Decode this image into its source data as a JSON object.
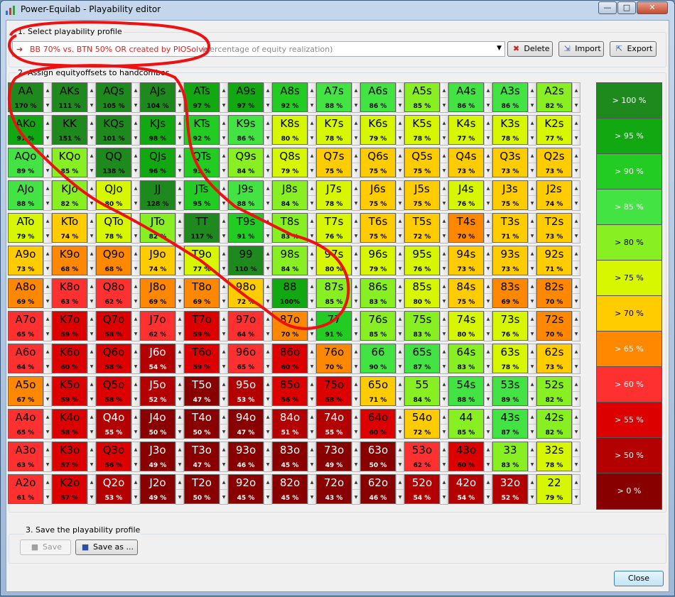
{
  "window": {
    "title": "Power-Equilab - Playability editor",
    "controls": [
      "—",
      "□",
      "✕"
    ]
  },
  "section1": {
    "label": "1. Select playability profile",
    "selected": "BB 70% vs. BTN 50% OR created by PIOSolver",
    "hint": "(percentage of equity realization)",
    "icon": "red-arrow-icon",
    "buttons": {
      "delete": "Delete",
      "import": "Import",
      "export": "Export"
    }
  },
  "section2": {
    "label": "2. Assign equityoffsets to handcombos"
  },
  "section3": {
    "label": "3. Save the playability profile",
    "save": "Save",
    "save_as": "Save as ..."
  },
  "close": "Close",
  "legend": [
    "> 100 %",
    "> 95 %",
    "> 90 %",
    "> 85 %",
    "> 80 %",
    "> 75 %",
    "> 70 %",
    "> 65 %",
    "> 60 %",
    "> 55 %",
    "> 50 %",
    "> 0 %"
  ],
  "colors": {
    "100": "#1e8a1e",
    "95": "#11a811",
    "90": "#22cc22",
    "85": "#44e344",
    "80": "#88f022",
    "75": "#d6f700",
    "70": "#ffcc00",
    "65": "#ff8800",
    "60": "#ff3030",
    "55": "#dd0000",
    "50": "#b30000",
    "0": "#880000"
  },
  "grid": [
    [
      [
        "AA",
        "170 %"
      ],
      [
        "AKs",
        "111 %"
      ],
      [
        "AQs",
        "105 %"
      ],
      [
        "AJs",
        "104 %"
      ],
      [
        "ATs",
        "97 %"
      ],
      [
        "A9s",
        "97 %"
      ],
      [
        "A8s",
        "92 %"
      ],
      [
        "A7s",
        "88 %"
      ],
      [
        "A6s",
        "86 %"
      ],
      [
        "A5s",
        "85 %"
      ],
      [
        "A4s",
        "86 %"
      ],
      [
        "A3s",
        "86 %"
      ],
      [
        "A2s",
        "82 %"
      ]
    ],
    [
      [
        "AKo",
        "97 %"
      ],
      [
        "KK",
        "151 %"
      ],
      [
        "KQs",
        "101 %"
      ],
      [
        "KJs",
        "98 %"
      ],
      [
        "KTs",
        "92 %"
      ],
      [
        "K9s",
        "86 %"
      ],
      [
        "K8s",
        "80 %"
      ],
      [
        "K7s",
        "78 %"
      ],
      [
        "K6s",
        "79 %"
      ],
      [
        "K5s",
        "78 %"
      ],
      [
        "K4s",
        "77 %"
      ],
      [
        "K3s",
        "78 %"
      ],
      [
        "K2s",
        "77 %"
      ]
    ],
    [
      [
        "AQo",
        "89 %"
      ],
      [
        "KQo",
        "85 %"
      ],
      [
        "QQ",
        "138 %"
      ],
      [
        "QJs",
        "96 %"
      ],
      [
        "QTs",
        "93 %"
      ],
      [
        "Q9s",
        "84 %"
      ],
      [
        "Q8s",
        "79 %"
      ],
      [
        "Q7s",
        "75 %"
      ],
      [
        "Q6s",
        "75 %"
      ],
      [
        "Q5s",
        "75 %"
      ],
      [
        "Q4s",
        "73 %"
      ],
      [
        "Q3s",
        "73 %"
      ],
      [
        "Q2s",
        "73 %"
      ]
    ],
    [
      [
        "AJo",
        "88 %"
      ],
      [
        "KJo",
        "82 %"
      ],
      [
        "QJo",
        "80 %"
      ],
      [
        "JJ",
        "128 %"
      ],
      [
        "JTs",
        "95 %"
      ],
      [
        "J9s",
        "88 %"
      ],
      [
        "J8s",
        "84 %"
      ],
      [
        "J7s",
        "78 %"
      ],
      [
        "J6s",
        "75 %"
      ],
      [
        "J5s",
        "75 %"
      ],
      [
        "J4s",
        "76 %"
      ],
      [
        "J3s",
        "75 %"
      ],
      [
        "J2s",
        "74 %"
      ]
    ],
    [
      [
        "ATo",
        "79 %"
      ],
      [
        "KTo",
        "74 %"
      ],
      [
        "QTo",
        "78 %"
      ],
      [
        "JTo",
        "82 %"
      ],
      [
        "TT",
        "117 %"
      ],
      [
        "T9s",
        "91 %"
      ],
      [
        "T8s",
        "83 %"
      ],
      [
        "T7s",
        "76 %"
      ],
      [
        "T6s",
        "75 %"
      ],
      [
        "T5s",
        "72 %"
      ],
      [
        "T4s",
        "70 %"
      ],
      [
        "T3s",
        "71 %"
      ],
      [
        "T2s",
        "73 %"
      ]
    ],
    [
      [
        "A9o",
        "73 %"
      ],
      [
        "K9o",
        "68 %"
      ],
      [
        "Q9o",
        "68 %"
      ],
      [
        "J9o",
        "74 %"
      ],
      [
        "T9o",
        "77 %"
      ],
      [
        "99",
        "110 %"
      ],
      [
        "98s",
        "84 %"
      ],
      [
        "97s",
        "80 %"
      ],
      [
        "96s",
        "79 %"
      ],
      [
        "95s",
        "76 %"
      ],
      [
        "94s",
        "73 %"
      ],
      [
        "93s",
        "73 %"
      ],
      [
        "92s",
        "71 %"
      ]
    ],
    [
      [
        "A8o",
        "69 %"
      ],
      [
        "K8o",
        "63 %"
      ],
      [
        "Q8o",
        "62 %"
      ],
      [
        "J8o",
        "69 %"
      ],
      [
        "T8o",
        "69 %"
      ],
      [
        "98o",
        "72 %"
      ],
      [
        "88",
        "100%"
      ],
      [
        "87s",
        "85 %"
      ],
      [
        "86s",
        "83 %"
      ],
      [
        "85s",
        "80 %"
      ],
      [
        "84s",
        "75 %"
      ],
      [
        "83s",
        "69 %"
      ],
      [
        "82s",
        "70 %"
      ]
    ],
    [
      [
        "A7o",
        "65 %"
      ],
      [
        "K7o",
        "59 %"
      ],
      [
        "Q7o",
        "58 %"
      ],
      [
        "J7o",
        "62 %"
      ],
      [
        "T7o",
        "59 %"
      ],
      [
        "97o",
        "64 %"
      ],
      [
        "87o",
        "70 %"
      ],
      [
        "77",
        "91 %"
      ],
      [
        "76s",
        "85 %"
      ],
      [
        "75s",
        "83 %"
      ],
      [
        "74s",
        "80 %"
      ],
      [
        "73s",
        "76 %"
      ],
      [
        "72s",
        "70 %"
      ]
    ],
    [
      [
        "A6o",
        "64 %"
      ],
      [
        "K6o",
        "60 %"
      ],
      [
        "Q6o",
        "58 %"
      ],
      [
        "J6o",
        "54 %"
      ],
      [
        "T6o",
        "59 %"
      ],
      [
        "96o",
        "65 %"
      ],
      [
        "86o",
        "60 %"
      ],
      [
        "76o",
        "70 %"
      ],
      [
        "66",
        "90 %"
      ],
      [
        "65s",
        "87 %"
      ],
      [
        "64s",
        "83 %"
      ],
      [
        "63s",
        "78 %"
      ],
      [
        "62s",
        "73 %"
      ]
    ],
    [
      [
        "A5o",
        "67 %"
      ],
      [
        "K5o",
        "59 %"
      ],
      [
        "Q5o",
        "58 %"
      ],
      [
        "J5o",
        "52 %"
      ],
      [
        "T5o",
        "47 %"
      ],
      [
        "95o",
        "53 %"
      ],
      [
        "85o",
        "56 %"
      ],
      [
        "75o",
        "58 %"
      ],
      [
        "65o",
        "71 %"
      ],
      [
        "55",
        "84 %"
      ],
      [
        "54s",
        "88 %"
      ],
      [
        "53s",
        "89 %"
      ],
      [
        "52s",
        "82 %"
      ]
    ],
    [
      [
        "A4o",
        "65 %"
      ],
      [
        "K4o",
        "58 %"
      ],
      [
        "Q4o",
        "55 %"
      ],
      [
        "J4o",
        "50 %"
      ],
      [
        "T4o",
        "50 %"
      ],
      [
        "94o",
        "47 %"
      ],
      [
        "84o",
        "51 %"
      ],
      [
        "74o",
        "55 %"
      ],
      [
        "64o",
        "60 %"
      ],
      [
        "54o",
        "72 %"
      ],
      [
        "44",
        "85 %"
      ],
      [
        "43s",
        "87 %"
      ],
      [
        "42s",
        "82 %"
      ]
    ],
    [
      [
        "A3o",
        "63 %"
      ],
      [
        "K3o",
        "57 %"
      ],
      [
        "Q3o",
        "56 %"
      ],
      [
        "J3o",
        "49 %"
      ],
      [
        "T3o",
        "47 %"
      ],
      [
        "93o",
        "46 %"
      ],
      [
        "83o",
        "45 %"
      ],
      [
        "73o",
        "49 %"
      ],
      [
        "63o",
        "50 %"
      ],
      [
        "53o",
        "62 %"
      ],
      [
        "43o",
        "60 %"
      ],
      [
        "33",
        "83 %"
      ],
      [
        "32s",
        "78 %"
      ]
    ],
    [
      [
        "A2o",
        "61 %"
      ],
      [
        "K2o",
        "57 %"
      ],
      [
        "Q2o",
        "53 %"
      ],
      [
        "J2o",
        "49 %"
      ],
      [
        "T2o",
        "50 %"
      ],
      [
        "92o",
        "45 %"
      ],
      [
        "82o",
        "45 %"
      ],
      [
        "72o",
        "43 %"
      ],
      [
        "62o",
        "46 %"
      ],
      [
        "52o",
        "54 %"
      ],
      [
        "42o",
        "54 %"
      ],
      [
        "32o",
        "52 %"
      ],
      [
        "22",
        "79 %"
      ]
    ]
  ]
}
